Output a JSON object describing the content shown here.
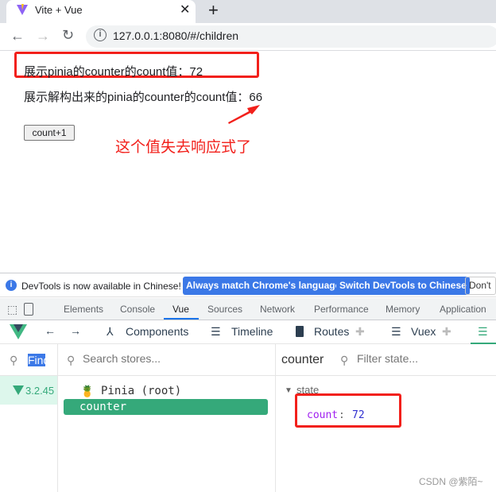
{
  "browser": {
    "tab_title": "Vite + Vue",
    "url": "127.0.0.1:8080/#/children"
  },
  "page": {
    "line1": "展示pinia的counter的count值：72",
    "line2": "展示解构出来的pinia的counter的count值：66",
    "button": "count+1",
    "annotation": "这个值失去响应式了"
  },
  "devtools": {
    "info": "DevTools is now available in Chinese!",
    "btn_match": "Always match Chrome's language",
    "btn_switch": "Switch DevTools to Chinese",
    "btn_dont": "Don't s",
    "tabs": [
      "Elements",
      "Console",
      "Vue",
      "Sources",
      "Network",
      "Performance",
      "Memory",
      "Application"
    ],
    "active_tab": "Vue",
    "vue_tabs": [
      "Components",
      "Timeline",
      "Routes",
      "Vuex"
    ],
    "find": "Find",
    "version": "3.2.45",
    "search_stores_placeholder": "Search stores...",
    "pinia_root": "Pinia (root)",
    "store": "counter",
    "state_header": "counter",
    "filter_placeholder": "Filter state...",
    "state_label": "state",
    "state_key": "count",
    "state_value": "72"
  },
  "watermark": "CSDN @紫陌~",
  "colors": {
    "vue_green": "#35a97a",
    "highlight": "#f2201b",
    "link_blue": "#3b78e7"
  }
}
